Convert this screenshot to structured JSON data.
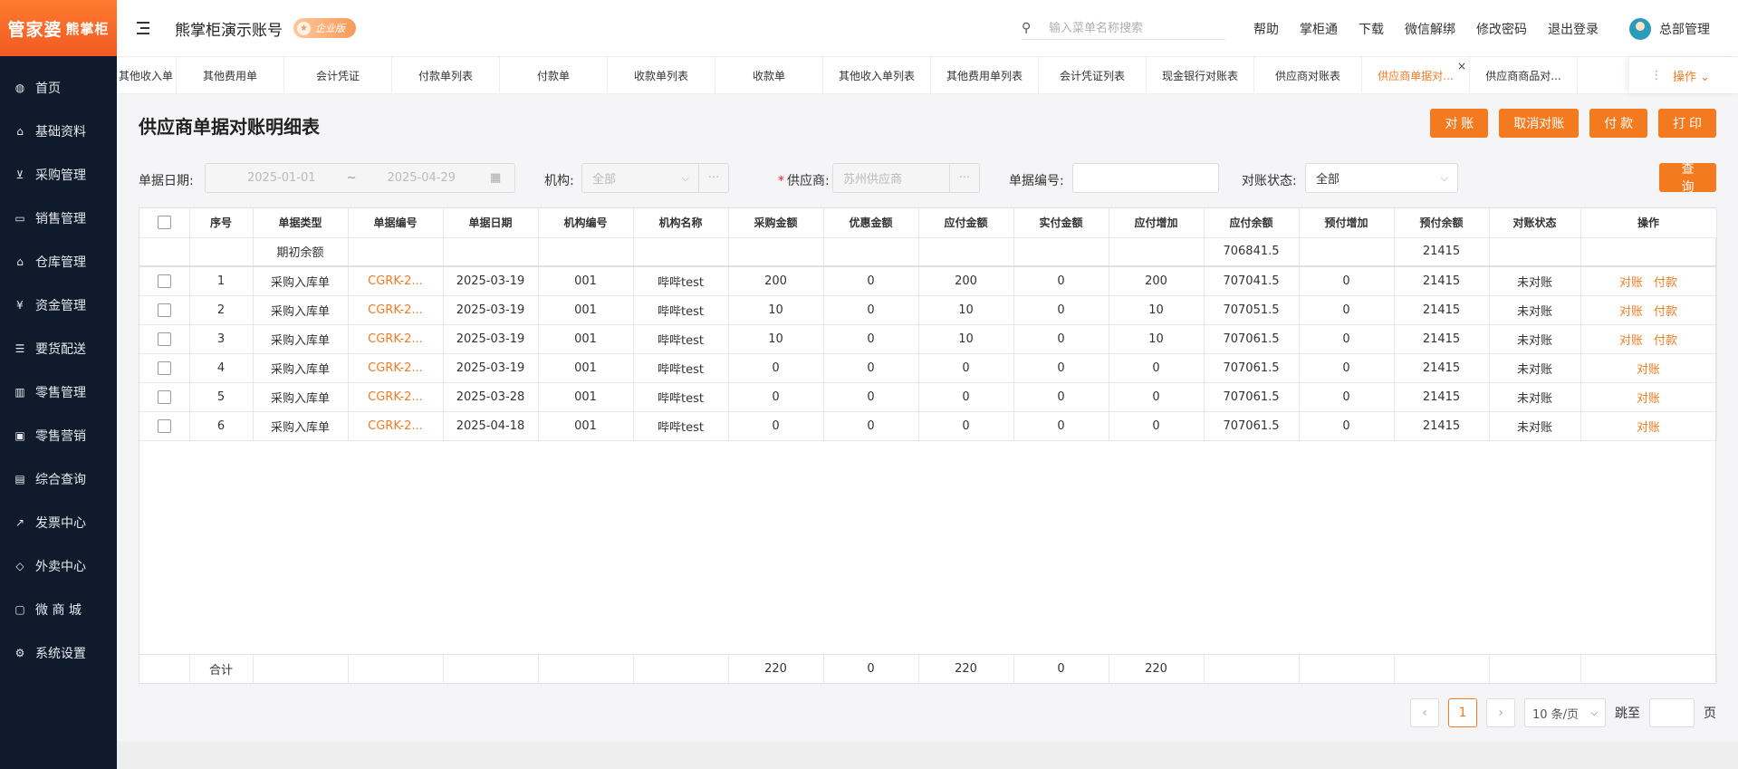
{
  "brand": {
    "logo_main": "管家婆",
    "logo_sub": "熊掌柜"
  },
  "sidebar": {
    "items": [
      {
        "label": "首页",
        "icon": "globe-icon"
      },
      {
        "label": "基础资料",
        "icon": "home-icon"
      },
      {
        "label": "采购管理",
        "icon": "cart-icon"
      },
      {
        "label": "销售管理",
        "icon": "chart-card-icon"
      },
      {
        "label": "仓库管理",
        "icon": "warehouse-icon"
      },
      {
        "label": "资金管理",
        "icon": "money-icon"
      },
      {
        "label": "要货配送",
        "icon": "list-icon"
      },
      {
        "label": "零售管理",
        "icon": "bar-chart-icon"
      },
      {
        "label": "零售营销",
        "icon": "gift-icon"
      },
      {
        "label": "综合查询",
        "icon": "stats-icon"
      },
      {
        "label": "发票中心",
        "icon": "trend-icon"
      },
      {
        "label": "外卖中心",
        "icon": "delivery-icon"
      },
      {
        "label": "微 商 城",
        "icon": "shop-icon"
      },
      {
        "label": "系统设置",
        "icon": "gear-icon"
      }
    ]
  },
  "header": {
    "account_name": "熊掌柜演示账号",
    "edition_badge": "企业版",
    "search_placeholder": "输入菜单名称搜索",
    "links": [
      "帮助",
      "掌柜通",
      "下载",
      "微信解绑",
      "修改密码",
      "退出登录"
    ],
    "user_name": "总部管理"
  },
  "tabs": {
    "items": [
      "其他收入单",
      "其他费用单",
      "会计凭证",
      "付款单列表",
      "付款单",
      "收款单列表",
      "收款单",
      "其他收入单列表",
      "其他费用单列表",
      "会计凭证列表",
      "现金银行对账表",
      "供应商对账表",
      "供应商单据对...",
      "供应商商品对..."
    ],
    "active_index": 12,
    "ops_label": "操作"
  },
  "page": {
    "title": "供应商单据对账明细表",
    "buttons": [
      "对 账",
      "取消对账",
      "付 款",
      "打 印"
    ],
    "query_button": "查 询"
  },
  "filters": {
    "date_label": "单据日期:",
    "date_start": "2025-01-01",
    "date_sep": "~",
    "date_end": "2025-04-29",
    "org_label": "机构:",
    "org_value": "全部",
    "supplier_label": "供应商:",
    "supplier_value": "苏州供应商",
    "docno_label": "单据编号:",
    "docno_value": "",
    "status_label": "对账状态:",
    "status_value": "全部"
  },
  "table": {
    "headers": [
      "序号",
      "单据类型",
      "单据编号",
      "单据日期",
      "机构编号",
      "机构名称",
      "采购金额",
      "优惠金额",
      "应付金额",
      "实付金额",
      "应付增加",
      "应付余额",
      "预付增加",
      "预付余额",
      "对账状态",
      "操作"
    ],
    "opening": {
      "label": "期初余额",
      "payable_balance": "706841.5",
      "prepay_balance": "21415"
    },
    "rows": [
      {
        "no": "1",
        "type": "采购入库单",
        "code": "CGRK-2...",
        "date": "2025-03-19",
        "org_code": "001",
        "org_name": "哔哔test",
        "purchase": "200",
        "discount": "0",
        "payable": "200",
        "paid": "0",
        "payable_inc": "200",
        "payable_bal": "707041.5",
        "prepay_inc": "0",
        "prepay_bal": "21415",
        "status": "未对账",
        "op1": "对账",
        "op2": "付款"
      },
      {
        "no": "2",
        "type": "采购入库单",
        "code": "CGRK-2...",
        "date": "2025-03-19",
        "org_code": "001",
        "org_name": "哔哔test",
        "purchase": "10",
        "discount": "0",
        "payable": "10",
        "paid": "0",
        "payable_inc": "10",
        "payable_bal": "707051.5",
        "prepay_inc": "0",
        "prepay_bal": "21415",
        "status": "未对账",
        "op1": "对账",
        "op2": "付款"
      },
      {
        "no": "3",
        "type": "采购入库单",
        "code": "CGRK-2...",
        "date": "2025-03-19",
        "org_code": "001",
        "org_name": "哔哔test",
        "purchase": "10",
        "discount": "0",
        "payable": "10",
        "paid": "0",
        "payable_inc": "10",
        "payable_bal": "707061.5",
        "prepay_inc": "0",
        "prepay_bal": "21415",
        "status": "未对账",
        "op1": "对账",
        "op2": "付款"
      },
      {
        "no": "4",
        "type": "采购入库单",
        "code": "CGRK-2...",
        "date": "2025-03-19",
        "org_code": "001",
        "org_name": "哔哔test",
        "purchase": "0",
        "discount": "0",
        "payable": "0",
        "paid": "0",
        "payable_inc": "0",
        "payable_bal": "707061.5",
        "prepay_inc": "0",
        "prepay_bal": "21415",
        "status": "未对账",
        "op1": "对账",
        "op2": ""
      },
      {
        "no": "5",
        "type": "采购入库单",
        "code": "CGRK-2...",
        "date": "2025-03-28",
        "org_code": "001",
        "org_name": "哔哔test",
        "purchase": "0",
        "discount": "0",
        "payable": "0",
        "paid": "0",
        "payable_inc": "0",
        "payable_bal": "707061.5",
        "prepay_inc": "0",
        "prepay_bal": "21415",
        "status": "未对账",
        "op1": "对账",
        "op2": ""
      },
      {
        "no": "6",
        "type": "采购入库单",
        "code": "CGRK-2...",
        "date": "2025-04-18",
        "org_code": "001",
        "org_name": "哔哔test",
        "purchase": "0",
        "discount": "0",
        "payable": "0",
        "paid": "0",
        "payable_inc": "0",
        "payable_bal": "707061.5",
        "prepay_inc": "0",
        "prepay_bal": "21415",
        "status": "未对账",
        "op1": "对账",
        "op2": ""
      }
    ],
    "totals": {
      "label": "合计",
      "purchase": "220",
      "discount": "0",
      "payable": "220",
      "paid": "0",
      "payable_inc": "220"
    }
  },
  "pagination": {
    "current": "1",
    "page_size": "10 条/页",
    "jump_label": "跳至",
    "page_unit": "页"
  },
  "colors": {
    "accent": "#f47a20",
    "sidebar_bg": "#0f1b2d"
  }
}
